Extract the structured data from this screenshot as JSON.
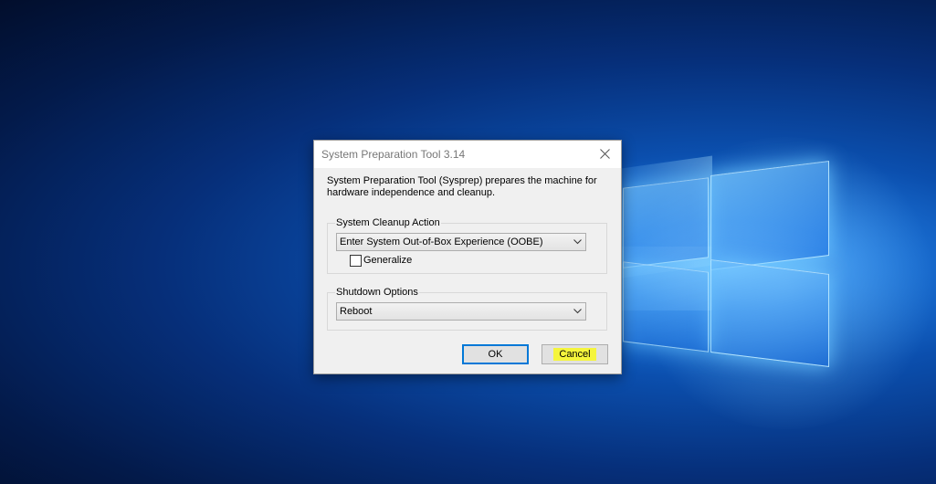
{
  "window": {
    "title": "System Preparation Tool 3.14",
    "description": "System Preparation Tool (Sysprep) prepares the machine for hardware independence and cleanup."
  },
  "cleanup": {
    "group_label": "System Cleanup Action",
    "selected": "Enter System Out-of-Box Experience (OOBE)",
    "generalize_label": "Generalize",
    "generalize_checked": false
  },
  "shutdown": {
    "group_label": "Shutdown Options",
    "selected": "Reboot"
  },
  "buttons": {
    "ok_label": "OK",
    "cancel_label": "Cancel",
    "cancel_highlight_color": "#f5f53c"
  },
  "icons": {
    "close": "close-icon",
    "dropdown": "chevron-down-icon"
  },
  "colors": {
    "accent": "#0078d7",
    "desktop": "#0b4fae"
  }
}
